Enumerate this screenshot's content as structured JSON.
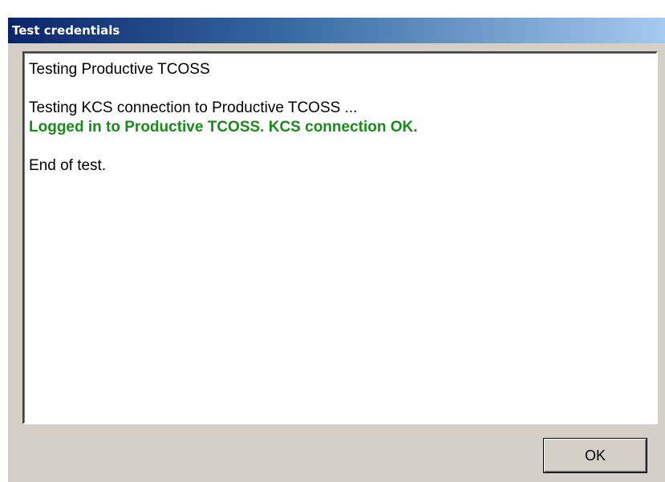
{
  "window": {
    "title": "Test credentials"
  },
  "log": {
    "lines": [
      {
        "text": "Testing Productive TCOSS",
        "color": "#000000"
      },
      {
        "text": "",
        "color": "#000000"
      },
      {
        "text": "Testing KCS connection to Productive TCOSS ...",
        "color": "#000000"
      },
      {
        "text": "Logged in to Productive TCOSS. KCS connection OK.",
        "color": "#1a8a1a"
      },
      {
        "text": "",
        "color": "#000000"
      },
      {
        "text": "End of test.",
        "color": "#000000"
      }
    ]
  },
  "buttons": {
    "ok_label": "OK"
  }
}
